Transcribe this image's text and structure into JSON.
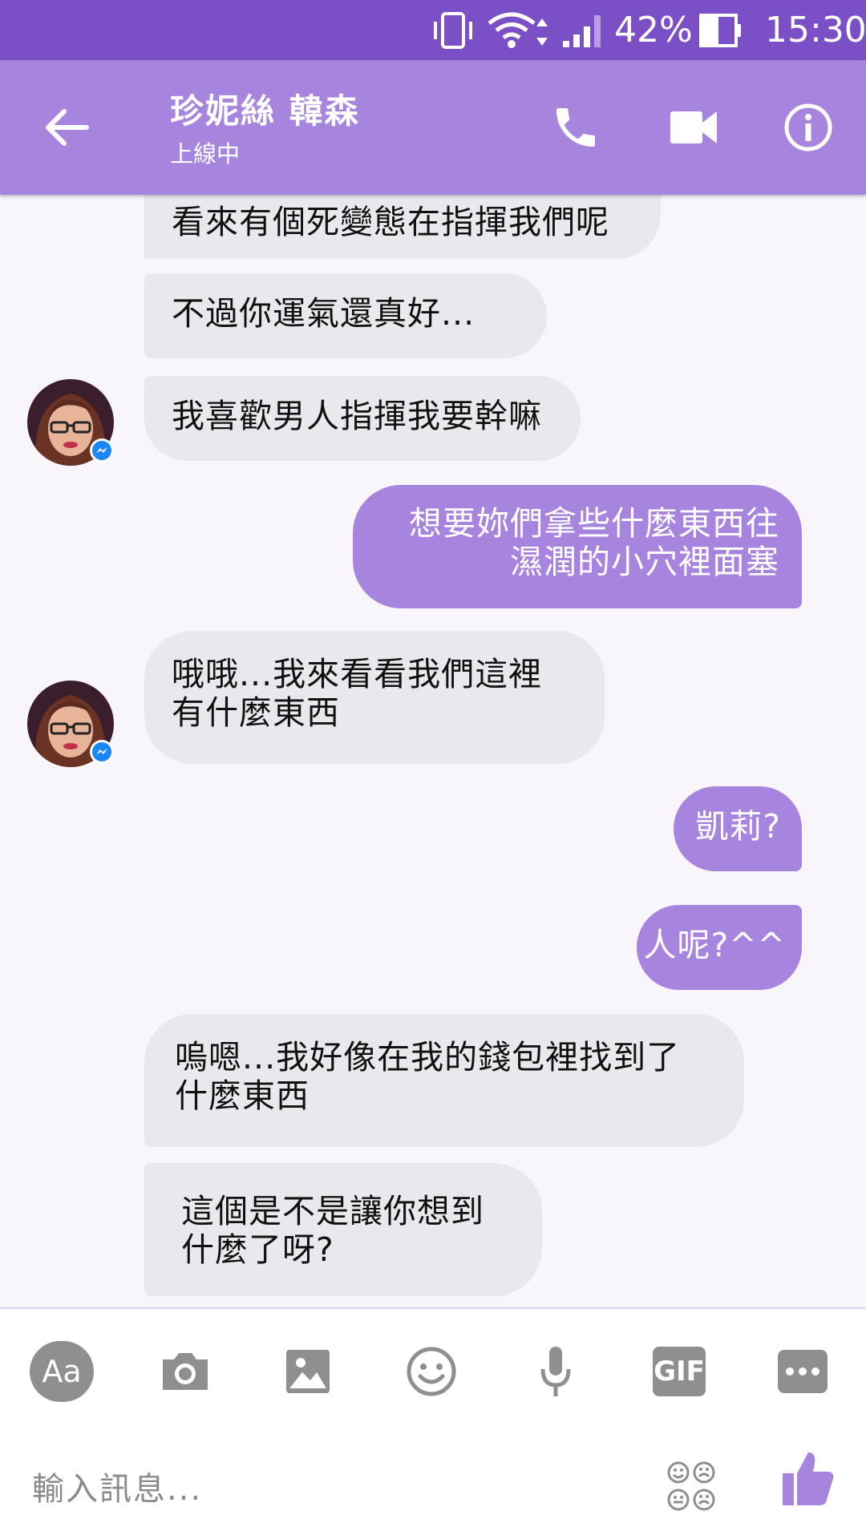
{
  "status_bar": {
    "battery_percent": "42%",
    "time": "15:30",
    "icons": [
      "vibrate-icon",
      "wifi-icon",
      "signal-icon",
      "battery-icon"
    ]
  },
  "header": {
    "contact_name": "珍妮絲 韓森",
    "contact_status": "上線中",
    "icons": [
      "back-arrow-icon",
      "phone-icon",
      "video-icon",
      "info-icon"
    ]
  },
  "colors": {
    "status_bar": "#7b4fc6",
    "header": "#a785de",
    "outgoing_bubble": "#a785de",
    "incoming_bubble": "#e9e8ed",
    "background": "#f8f5fb"
  },
  "messages": [
    {
      "direction": "incoming",
      "text": "看來有個死變態在指揮我們呢"
    },
    {
      "direction": "incoming",
      "text": "不過你運氣還真好..."
    },
    {
      "direction": "incoming",
      "text": "我喜歡男人指揮我要幹嘛"
    },
    {
      "direction": "outgoing",
      "line1": "想要妳們拿些什麼東西往",
      "line2": "濕潤的小穴裡面塞"
    },
    {
      "direction": "incoming",
      "line1": "哦哦...我來看看我們這裡",
      "line2": "有什麼東西"
    },
    {
      "direction": "outgoing",
      "text": "凱莉?"
    },
    {
      "direction": "outgoing",
      "text": "人呢?^^"
    },
    {
      "direction": "incoming",
      "line1": "嗚嗯...我好像在我的錢包裡找到了",
      "line2": "什麼東西"
    },
    {
      "direction": "incoming",
      "line1": "這個是不是讓你想到",
      "line2": "什麼了呀?"
    }
  ],
  "toolbar": {
    "aa_label": "Aa",
    "gif_label": "GIF",
    "icons": [
      "camera-icon",
      "image-icon",
      "emoji-icon",
      "microphone-icon",
      "more-icon",
      "sticker-icon",
      "thumbs-up-icon"
    ]
  },
  "composer": {
    "placeholder": "輸入訊息..."
  }
}
